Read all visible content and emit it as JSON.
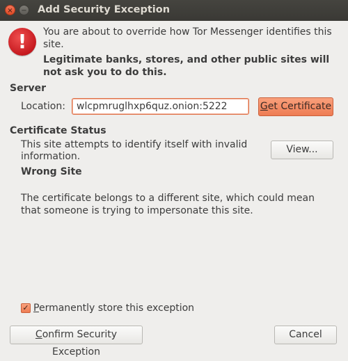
{
  "window": {
    "title": "Add Security Exception",
    "close_icon": "×",
    "minimize_icon": "−"
  },
  "warning": {
    "icon": "!",
    "message": "You are about to override how Tor Messenger identifies this site.",
    "bold_message": "Legitimate banks, stores, and other public sites will not ask you to do this."
  },
  "server": {
    "heading": "Server",
    "location_label": "Location:",
    "location_value": "wlcpmruglhxp6quz.onion:5222",
    "get_certificate_prefix": "G",
    "get_certificate_rest": "et Certificate"
  },
  "certificate_status": {
    "heading": "Certificate Status",
    "description": "This site attempts to identify itself with invalid information.",
    "view_label": "View...",
    "problem_title": "Wrong Site",
    "problem_text": "The certificate belongs to a different site, which could mean that someone is trying to impersonate this site."
  },
  "options": {
    "checkbox_mark": "✓",
    "permanently_store_prefix": "P",
    "permanently_store_rest": "ermanently store this exception",
    "permanently_store_checked": true
  },
  "footer": {
    "confirm_prefix": "C",
    "confirm_rest": "onfirm Security Exception",
    "cancel_label": "Cancel"
  },
  "colors": {
    "accent": "#ee7c53",
    "titlebar": "#3f3e39",
    "warning_red": "#c6191f",
    "background": "#efeeec"
  }
}
